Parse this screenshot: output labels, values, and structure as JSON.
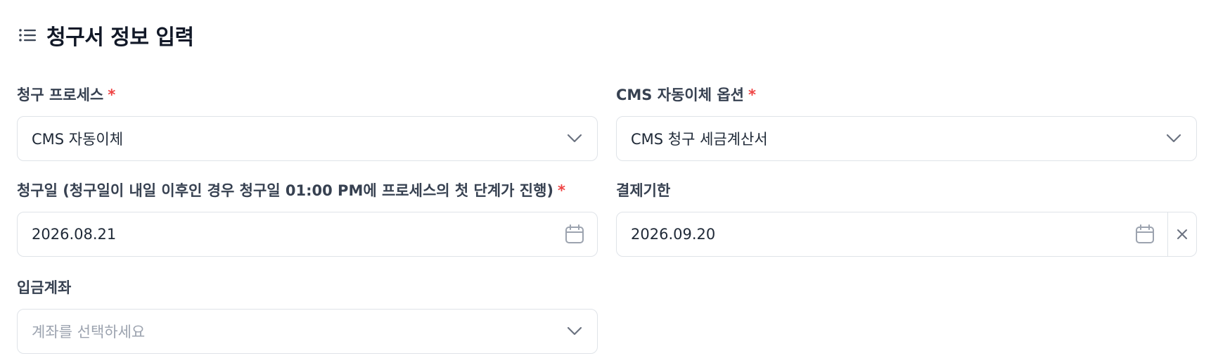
{
  "header": {
    "title": "청구서 정보 입력",
    "icon": "list-icon"
  },
  "fields": {
    "billing_process": {
      "label": "청구 프로세스",
      "required_mark": "*",
      "value": "CMS 자동이체",
      "icon": "chevron-down-icon"
    },
    "cms_option": {
      "label": "CMS 자동이체 옵션",
      "required_mark": "*",
      "value": "CMS 청구 세금계산서",
      "icon": "chevron-down-icon"
    },
    "billing_date": {
      "label": "청구일 (청구일이 내일 이후인 경우 청구일 01:00 PM에 프로세스의 첫 단계가 진행)",
      "required_mark": "*",
      "value": "2026.08.21",
      "icon": "calendar-icon"
    },
    "payment_due": {
      "label": "결제기한",
      "value": "2026.09.20",
      "icon": "calendar-icon",
      "clear_icon": "close-icon"
    },
    "deposit_account": {
      "label": "입금계좌",
      "placeholder": "계좌를 선택하세요",
      "icon": "chevron-down-icon"
    }
  },
  "colors": {
    "required": "#ef4444",
    "border": "#dfe3e8",
    "text": "#1f2937",
    "placeholder": "#9ca3af",
    "icon": "#9ca3af"
  }
}
